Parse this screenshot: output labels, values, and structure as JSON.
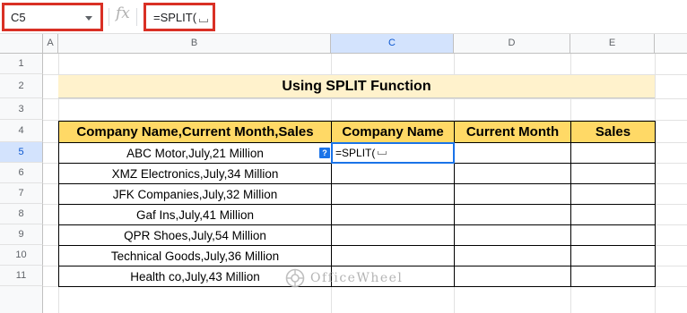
{
  "name_box": {
    "value": "C5"
  },
  "formula_bar": {
    "fx": "fx",
    "value": "=SPLIT("
  },
  "columns": [
    "A",
    "B",
    "C",
    "D",
    "E"
  ],
  "rows": [
    "1",
    "2",
    "3",
    "4",
    "5",
    "6",
    "7",
    "8",
    "9",
    "10",
    "11"
  ],
  "selected": {
    "column": "C",
    "row": "5"
  },
  "sheet": {
    "title": "Using SPLIT Function",
    "headers": [
      "Company Name,Current Month,Sales",
      "Company Name",
      "Current Month",
      "Sales"
    ],
    "data": [
      "ABC Motor,July,21 Million",
      "XMZ Electronics,July,34 Million",
      "JFK Companies,July,32 Million",
      "Gaf Ins,July,41 Million",
      "QPR Shoes,July,54 Million",
      "Technical Goods,July,36 Million",
      "Health co,July,43 Million"
    ],
    "active_cell_value": "=SPLIT(",
    "help_badge": "?"
  },
  "watermark": {
    "text": "OfficeWheel"
  },
  "colors": {
    "title_fill": "#fff2cc",
    "header_fill": "#ffd966",
    "selection": "#1a73e8",
    "callout_border": "#d93025"
  }
}
